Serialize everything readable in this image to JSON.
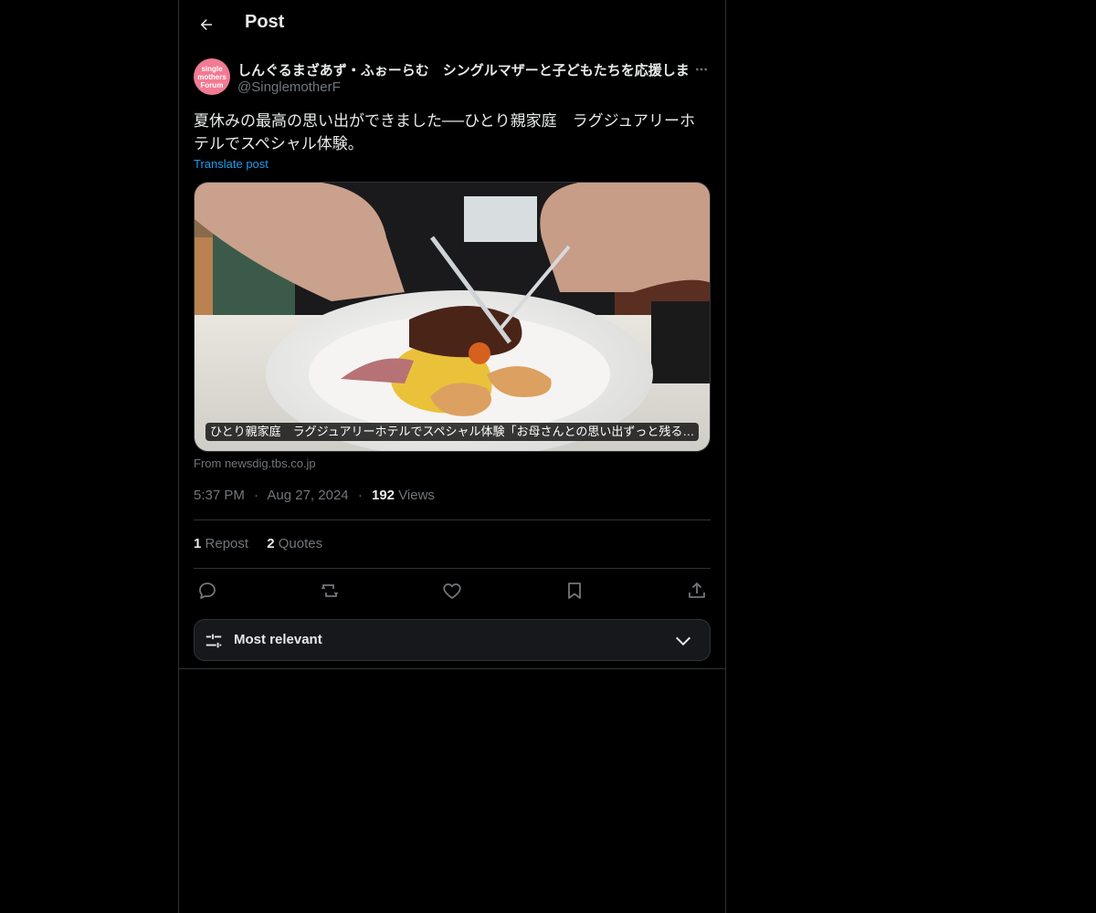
{
  "header": {
    "title": "Post"
  },
  "author": {
    "display_name": "しんぐるまざあず・ふぉーらむ　シングルマザーと子どもたちを応援しま",
    "handle": "@SinglemotherF",
    "avatar_text": [
      "single",
      "mothers",
      "Forum"
    ]
  },
  "post": {
    "text": "夏休みの最高の思い出ができました──ひとり親家庭　ラグジュアリーホテルでスペシャル体験。",
    "translate_label": "Translate post"
  },
  "card": {
    "caption": "ひとり親家庭　ラグジュアリーホテルでスペシャル体験「お母さんとの思い出ずっと残る…",
    "source": "From newsdig.tbs.co.jp"
  },
  "meta": {
    "time": "5:37 PM",
    "date": "Aug 27, 2024",
    "views_count": "192",
    "views_label": "Views",
    "separator": "·"
  },
  "stats": {
    "reposts_count": "1",
    "reposts_label": "Repost",
    "quotes_count": "2",
    "quotes_label": "Quotes"
  },
  "actions": [
    "reply-icon",
    "repost-icon",
    "like-icon",
    "bookmark-icon",
    "share-icon"
  ],
  "sort": {
    "label": "Most relevant"
  },
  "colors": {
    "accent": "#1d9bf0",
    "background": "#000000",
    "muted": "#71767b",
    "text": "#e7e9ea",
    "border": "#2f3336"
  }
}
